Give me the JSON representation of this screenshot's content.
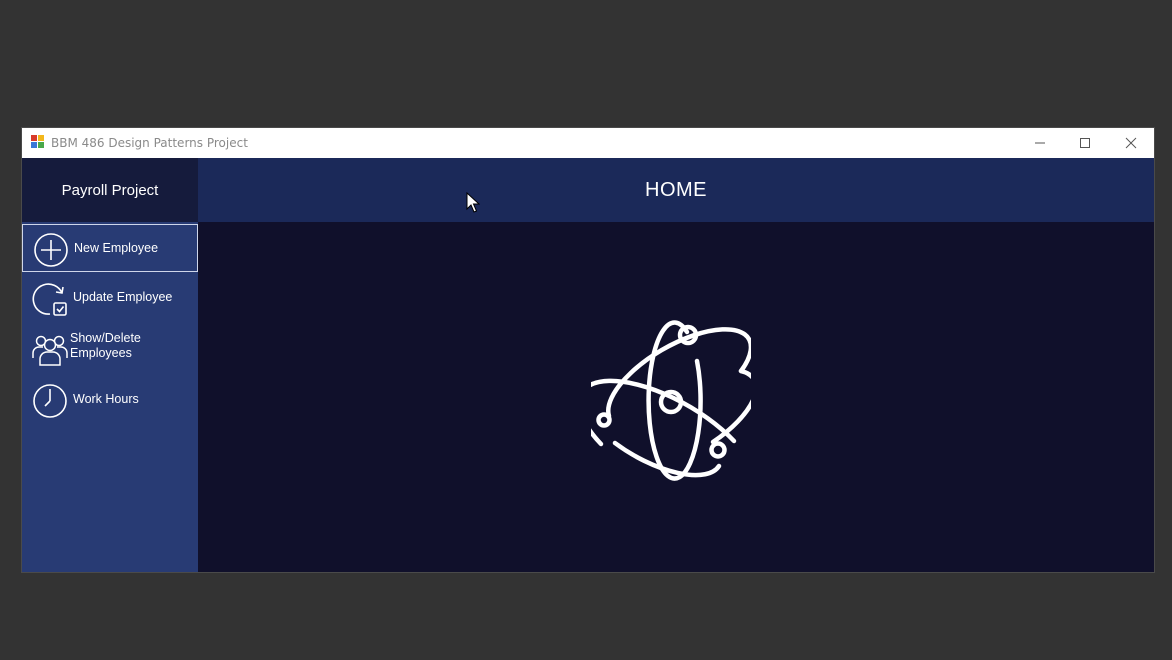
{
  "window": {
    "title": "BBM 486 Design Patterns Project",
    "controls": [
      "minimize-icon",
      "maximize-icon",
      "close-icon"
    ]
  },
  "sidebar": {
    "header": "Payroll Project",
    "items": [
      {
        "label": "New Employee",
        "icon": "plus-circle-icon",
        "active": true
      },
      {
        "label": "Update Employee",
        "icon": "refresh-check-icon",
        "active": false
      },
      {
        "label": "Show/Delete Employees",
        "label_line1": "Show/Delete",
        "label_line2": "Employees",
        "icon": "users-icon",
        "active": false
      },
      {
        "label": "Work Hours",
        "icon": "clock-icon",
        "active": false
      }
    ]
  },
  "main": {
    "title": "HOME",
    "center_icon": "atom-icon"
  },
  "colors": {
    "sidebar": "#283b74",
    "sidebar_header": "#151b3c",
    "topbar": "#1b2959",
    "content": "#10102b",
    "desktop": "#333333"
  }
}
